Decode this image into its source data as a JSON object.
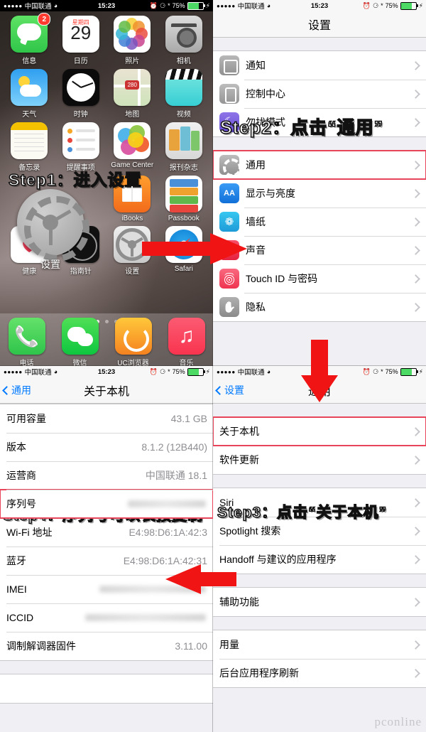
{
  "statusbar": {
    "signal_dots": "●●●●●",
    "carrier": "中国联通",
    "wifi_icon": "wifi-icon",
    "time": "15:23",
    "alarm_icon": "alarm-icon",
    "rotation_lock_icon": "rotation-lock-icon",
    "bluetooth_icon": "bluetooth-icon",
    "battery_percent": "75%",
    "battery_level": 75,
    "charging_icon": "charging-bolt-icon"
  },
  "homescreen": {
    "apps": [
      {
        "label": "信息",
        "icon": "messages-icon",
        "badge": "2"
      },
      {
        "label": "日历",
        "icon": "calendar-icon",
        "weekday": "星期四",
        "day": "29"
      },
      {
        "label": "照片",
        "icon": "photos-icon"
      },
      {
        "label": "相机",
        "icon": "camera-icon"
      },
      {
        "label": "天气",
        "icon": "weather-icon"
      },
      {
        "label": "时钟",
        "icon": "clock-icon"
      },
      {
        "label": "地图",
        "icon": "maps-icon",
        "shield": "280"
      },
      {
        "label": "视频",
        "icon": "videos-icon"
      },
      {
        "label": "备忘录",
        "icon": "notes-icon"
      },
      {
        "label": "提醒事项",
        "icon": "reminders-icon"
      },
      {
        "label": "Game Center",
        "icon": "game-center-icon"
      },
      {
        "label": "报刊杂志",
        "icon": "newsstand-icon"
      },
      {
        "label": "",
        "icon": "blank-icon"
      },
      {
        "label": "",
        "icon": "blank-icon"
      },
      {
        "label": "iBooks",
        "icon": "ibooks-icon"
      },
      {
        "label": "Passbook",
        "icon": "passbook-icon"
      },
      {
        "label": "健康",
        "icon": "health-icon"
      },
      {
        "label": "指南针",
        "icon": "compass-icon"
      },
      {
        "label": "设置",
        "icon": "settings-gear-icon"
      },
      {
        "label": "Safari",
        "icon": "safari-icon"
      }
    ],
    "dock": [
      {
        "label": "电话",
        "icon": "phone-icon"
      },
      {
        "label": "微信",
        "icon": "wechat-icon"
      },
      {
        "label": "UC浏览器",
        "icon": "uc-browser-icon"
      },
      {
        "label": "音乐",
        "icon": "music-icon"
      }
    ],
    "page_dots": 3,
    "active_page": 1,
    "overlay_gear_label": "设置"
  },
  "steps": {
    "step1": "Step1：进入设置",
    "step2": "Step2：点击“通用”",
    "step3": "Step3：点击“关于本机”",
    "step4": "Step4：序列号可以长按复制"
  },
  "settings_screen": {
    "title": "设置",
    "groups": [
      {
        "rows": [
          {
            "label": "通知",
            "icon": "notifications-icon"
          },
          {
            "label": "控制中心",
            "icon": "control-center-icon"
          },
          {
            "label": "勿扰模式",
            "icon": "do-not-disturb-icon"
          }
        ]
      },
      {
        "rows": [
          {
            "label": "通用",
            "icon": "general-gear-icon",
            "highlight": true
          },
          {
            "label": "显示与亮度",
            "icon": "display-brightness-icon"
          },
          {
            "label": "墙纸",
            "icon": "wallpaper-icon"
          },
          {
            "label": "声音",
            "icon": "sounds-icon"
          },
          {
            "label": "Touch ID 与密码",
            "icon": "touch-id-icon"
          },
          {
            "label": "隐私",
            "icon": "privacy-icon"
          }
        ]
      }
    ]
  },
  "general_screen": {
    "back_label": "设置",
    "title": "通用",
    "groups": [
      {
        "rows": [
          {
            "label": "关于本机",
            "highlight": true
          },
          {
            "label": "软件更新"
          }
        ]
      },
      {
        "rows": [
          {
            "label": "Siri"
          },
          {
            "label": "Spotlight 搜索"
          },
          {
            "label": "Handoff 与建议的应用程序"
          }
        ]
      },
      {
        "rows": [
          {
            "label": "辅助功能"
          }
        ]
      },
      {
        "rows": [
          {
            "label": "用量"
          },
          {
            "label": "后台应用程序刷新"
          }
        ]
      }
    ]
  },
  "about_screen": {
    "back_label": "通用",
    "title": "关于本机",
    "rows": [
      {
        "label": "可用容量",
        "value": "43.1 GB"
      },
      {
        "label": "版本",
        "value": "8.1.2 (12B440)"
      },
      {
        "label": "运营商",
        "value": "中国联通 18.1"
      },
      {
        "label": "序列号",
        "value": "",
        "blurred": true,
        "highlight": true
      },
      {
        "label": "Wi-Fi 地址",
        "value": "E4:98:D6:1A:42:3"
      },
      {
        "label": "蓝牙",
        "value": "E4:98:D6:1A:42:31"
      },
      {
        "label": "IMEI",
        "value": "",
        "blurred": true
      },
      {
        "label": "ICCID",
        "value": "",
        "blurred": true
      },
      {
        "label": "调制解调器固件",
        "value": "3.11.00"
      }
    ]
  },
  "watermark": "pconline",
  "colors": {
    "accent_red": "#f01414",
    "highlight_border": "#e8455a",
    "ios_blue": "#007aff",
    "list_bg": "#efeff4",
    "battery_green": "#4cd964"
  }
}
